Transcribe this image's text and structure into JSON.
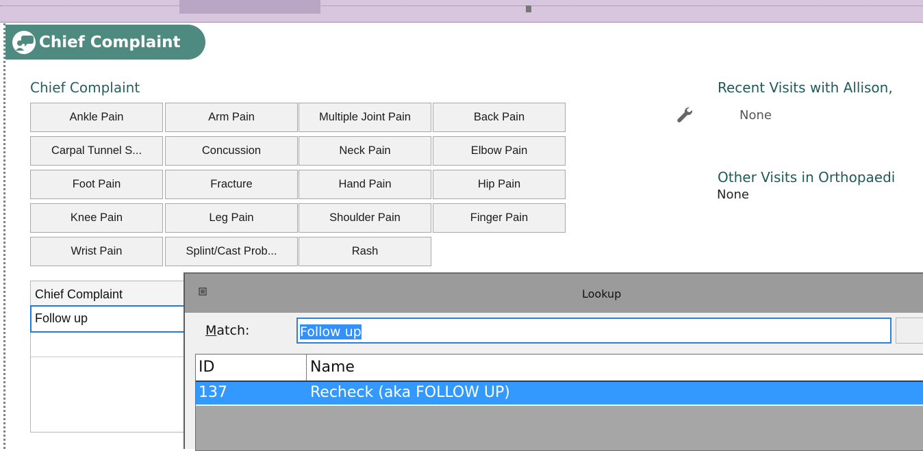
{
  "section": {
    "title": "Chief Complaint",
    "icon": "chief-complaint-icon"
  },
  "quick_list": {
    "label": "Chief Complaint",
    "buttons": [
      "Ankle Pain",
      "Arm Pain",
      "Multiple Joint Pain",
      "Back Pain",
      "Carpal Tunnel S...",
      "Concussion",
      "Neck Pain",
      "Elbow Pain",
      "Foot Pain",
      "Fracture",
      "Hand Pain",
      "Hip Pain",
      "Knee Pain",
      "Leg Pain",
      "Shoulder Pain",
      "Finger Pain",
      "Wrist Pain",
      "Splint/Cast Prob...",
      "Rash"
    ]
  },
  "complaint_table": {
    "header": "Chief Complaint",
    "value": "Follow up"
  },
  "recent_visits": {
    "title": "Recent Visits with Allison,",
    "value": "None",
    "icon": "wrench-icon"
  },
  "other_visits": {
    "title": "Other Visits in Orthopaedi",
    "value": "None"
  },
  "lookup": {
    "title": "Lookup",
    "match_label_prefix": "M",
    "match_label_rest": "atch:",
    "match_value": "Follow up",
    "columns": [
      "ID",
      "Name"
    ],
    "rows": [
      {
        "id": "137",
        "name": "Recheck (aka FOLLOW UP)"
      }
    ]
  },
  "colors": {
    "section_accent": "#4e8a80",
    "top_strip": "#d8c5de",
    "selection": "#3399ff"
  }
}
